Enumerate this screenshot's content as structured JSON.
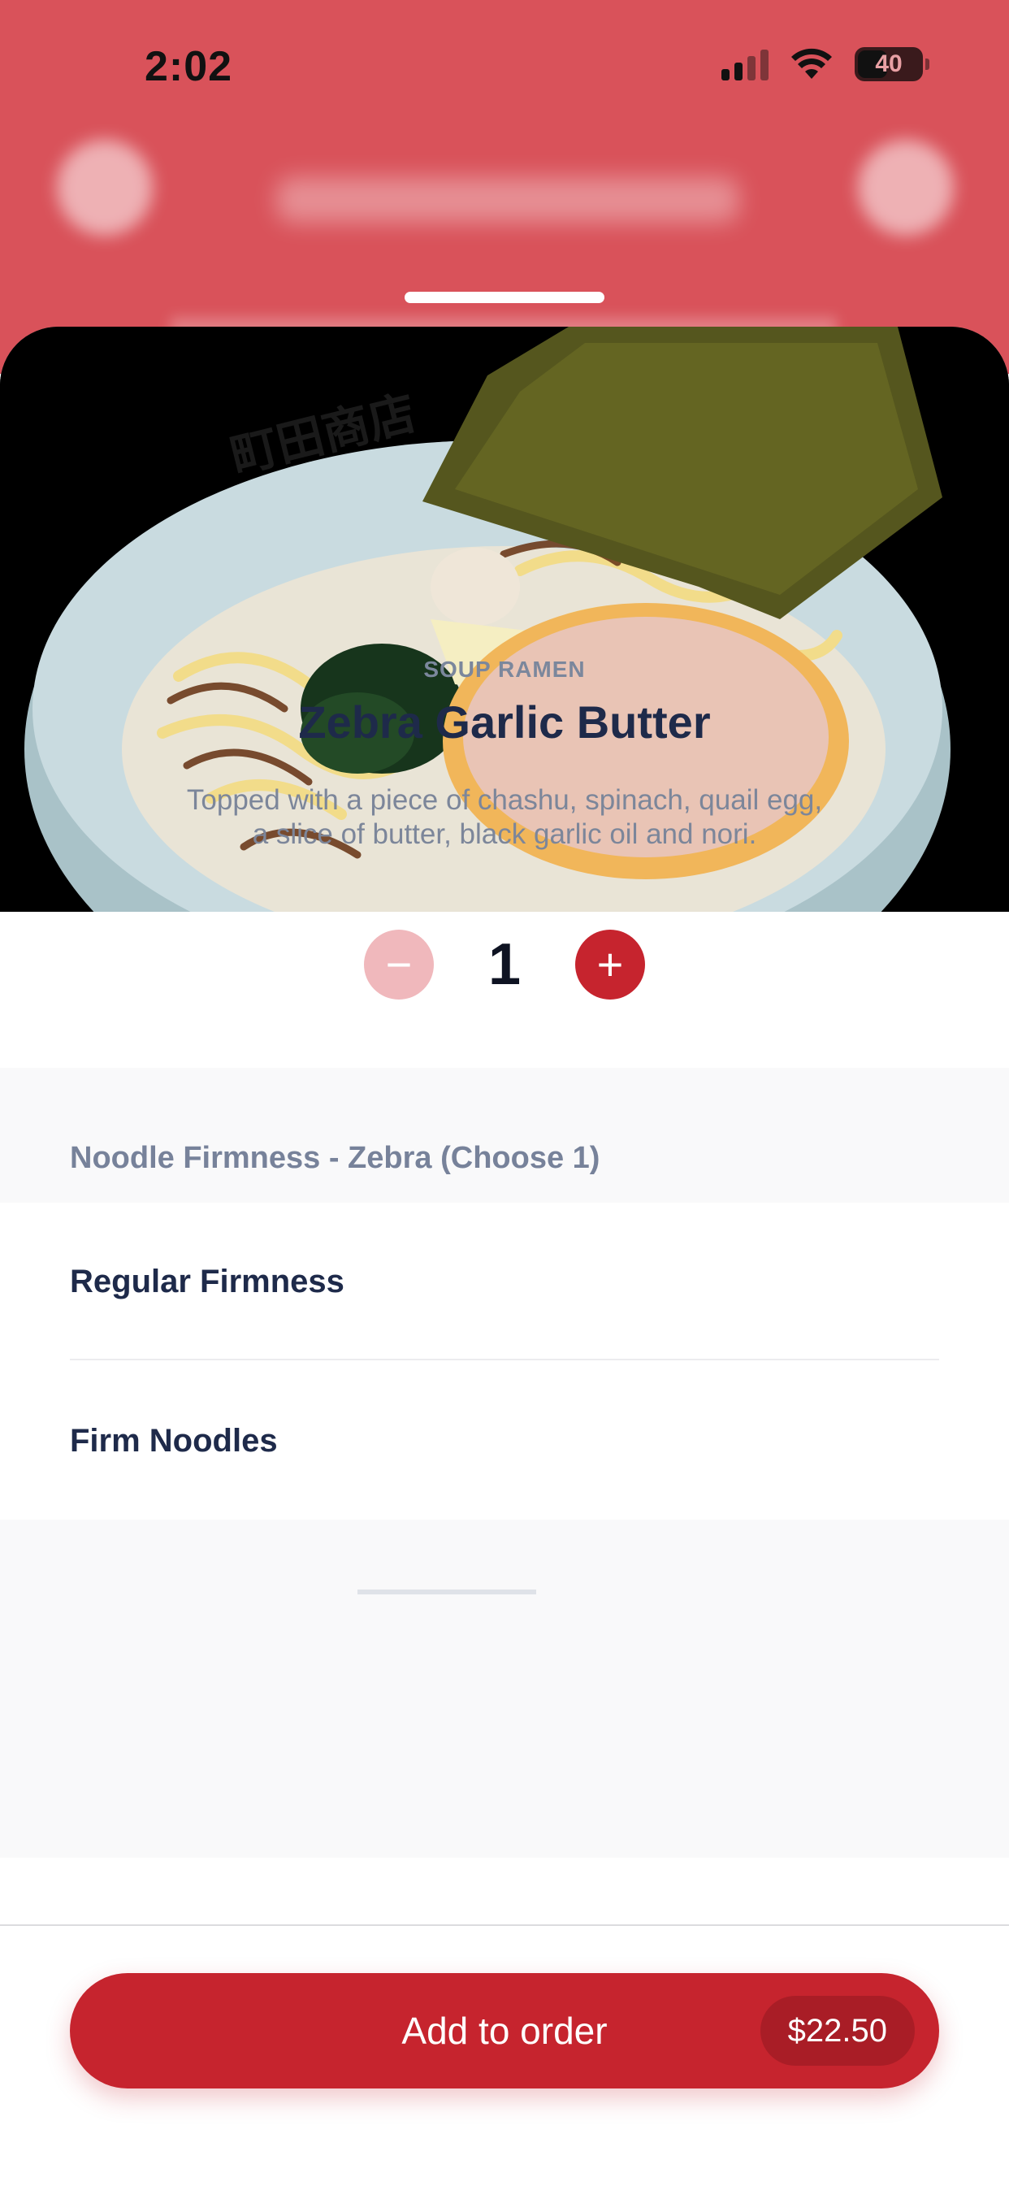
{
  "status_bar": {
    "time": "2:02",
    "battery": "40"
  },
  "item": {
    "category": "SOUP RAMEN",
    "name": "Zebra Garlic Butter",
    "description": "Topped with a piece of chashu, spinach, quail egg, a slice of butter, black garlic oil and nori.",
    "quantity": "1",
    "image_text": "町田商店"
  },
  "quantity_controls": {
    "minus": "−",
    "plus": "+"
  },
  "options": {
    "section_title": "Noodle Firmness - Zebra (Choose 1)",
    "items": [
      {
        "label": "Regular Firmness"
      },
      {
        "label": "Firm Noodles"
      }
    ]
  },
  "footer": {
    "add_label": "Add to order",
    "price": "$22.50"
  },
  "colors": {
    "brand_red": "#c6242e",
    "header_red": "#d9525a",
    "text_dark": "#1e2a4a",
    "text_muted": "#7c869a"
  }
}
